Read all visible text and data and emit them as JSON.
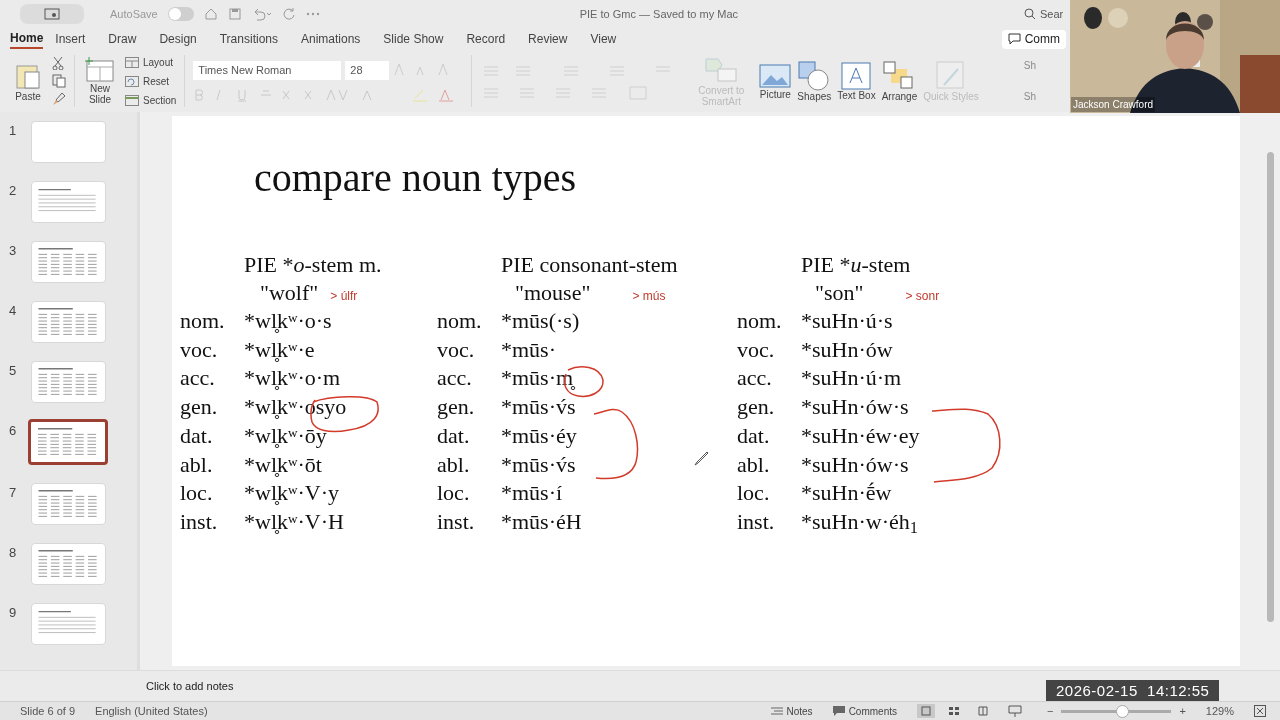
{
  "titlebar": {
    "autosave": {
      "label": "AutoSave",
      "on": false
    },
    "document_title": "PIE to Gmc — Saved to my Mac",
    "search": "Sear"
  },
  "tabs": [
    {
      "label": "Home",
      "selected": true
    },
    {
      "label": "Insert",
      "selected": false
    },
    {
      "label": "Draw",
      "selected": false
    },
    {
      "label": "Design",
      "selected": false
    },
    {
      "label": "Transitions",
      "selected": false
    },
    {
      "label": "Animations",
      "selected": false
    },
    {
      "label": "Slide Show",
      "selected": false
    },
    {
      "label": "Record",
      "selected": false
    },
    {
      "label": "Review",
      "selected": false
    },
    {
      "label": "View",
      "selected": false
    }
  ],
  "comments_button": "Comm",
  "ribbon": {
    "paste": "Paste",
    "new_slide": "New Slide",
    "layout": "Layout",
    "reset": "Reset",
    "section": "Section",
    "font": "Times New Roman",
    "font_size": "28",
    "big_buttons": [
      {
        "label": "Convert to SmartArt",
        "disabled": true
      },
      {
        "label": "Picture",
        "disabled": false
      },
      {
        "label": "Shapes",
        "disabled": false
      },
      {
        "label": "Text Box",
        "disabled": false
      },
      {
        "label": "Arrange",
        "disabled": false
      },
      {
        "label": "Quick Styles",
        "disabled": true
      }
    ],
    "cut_labels": [
      "Sh",
      "Sh"
    ]
  },
  "thumbnails": [
    {
      "number": "1",
      "kind": "blank",
      "selected": false
    },
    {
      "number": "2",
      "kind": "text",
      "selected": false
    },
    {
      "number": "3",
      "kind": "table",
      "selected": false
    },
    {
      "number": "4",
      "kind": "table",
      "selected": false
    },
    {
      "number": "5",
      "kind": "table",
      "selected": false
    },
    {
      "number": "6",
      "kind": "table",
      "selected": true
    },
    {
      "number": "7",
      "kind": "table",
      "selected": false
    },
    {
      "number": "8",
      "kind": "table",
      "selected": false
    },
    {
      "number": "9",
      "kind": "text",
      "selected": false
    }
  ],
  "slide": {
    "title": "compare noun types",
    "columns": [
      {
        "heading": {
          "prefix": "PIE *",
          "stem": "o",
          "suffix": "-stem m."
        },
        "gloss": "\"wolf\"",
        "note": "> úlfr",
        "rows": [
          {
            "case": "nom.",
            "form": "*wl̥kʷ·o·s"
          },
          {
            "case": "voc.",
            "form": "*wl̥kʷ·e"
          },
          {
            "case": "acc.",
            "form": "*wl̥kʷ·o·m"
          },
          {
            "case": "gen.",
            "form": "*wl̥kʷ·osyo"
          },
          {
            "case": "dat.",
            "form": "*wl̥kʷ·ōy"
          },
          {
            "case": "abl.",
            "form": "*wl̥kʷ·ōt"
          },
          {
            "case": "loc.",
            "form": "*wl̥kʷ·V·y"
          },
          {
            "case": "inst.",
            "form": "*wl̥kʷ·V·H"
          }
        ]
      },
      {
        "heading": {
          "prefix": "PIE consonant-stem"
        },
        "gloss": "\"mouse\"",
        "note": "> mús",
        "rows": [
          {
            "case": "nom.",
            "form": "*mūs(·s)"
          },
          {
            "case": "voc.",
            "form": "*mūs·"
          },
          {
            "case": "acc.",
            "form": "*mūs·m̥"
          },
          {
            "case": "gen.",
            "form": "*mūs·v́s"
          },
          {
            "case": "dat.",
            "form": "*mūs·éy"
          },
          {
            "case": "abl.",
            "form": "*mūs·v́s"
          },
          {
            "case": "loc.",
            "form": "*mūs·í"
          },
          {
            "case": "inst.",
            "form": "*mūs·éH"
          }
        ]
      },
      {
        "heading": {
          "prefix": "PIE *",
          "stem": "u",
          "suffix": "-stem"
        },
        "gloss": "\"son\"",
        "note": "> sonr",
        "rows": [
          {
            "case": "nom.",
            "form": "*suHn·ú·s"
          },
          {
            "case": "voc.",
            "form": "*suHn·ów"
          },
          {
            "case": "acc.",
            "form": "*suHn·ú·m"
          },
          {
            "case": "gen.",
            "form": "*suHn·ów·s"
          },
          {
            "case": "dat.",
            "form": "*suHn·éw·ey"
          },
          {
            "case": "abl.",
            "form": "*suHn·ów·s"
          },
          {
            "case": "loc.",
            "form": "*suHn·ḗw"
          },
          {
            "case": "inst.",
            "form": "*suHn·w·éh$_{1}$"
          }
        ]
      }
    ]
  },
  "notes_placeholder": "Click to add notes",
  "status_bar": {
    "slide": "Slide 6 of 9",
    "language": "English (United States)",
    "notes": "Notes",
    "comments": "Comments",
    "zoom": {
      "level": 0.55
    },
    "zoom_out": "−",
    "zoom_in": "+",
    "zoom_percent": "129%"
  },
  "video_overlay": {
    "name": "Jackson Crawford"
  },
  "timestamp": "2026-02-15  14:12:55"
}
